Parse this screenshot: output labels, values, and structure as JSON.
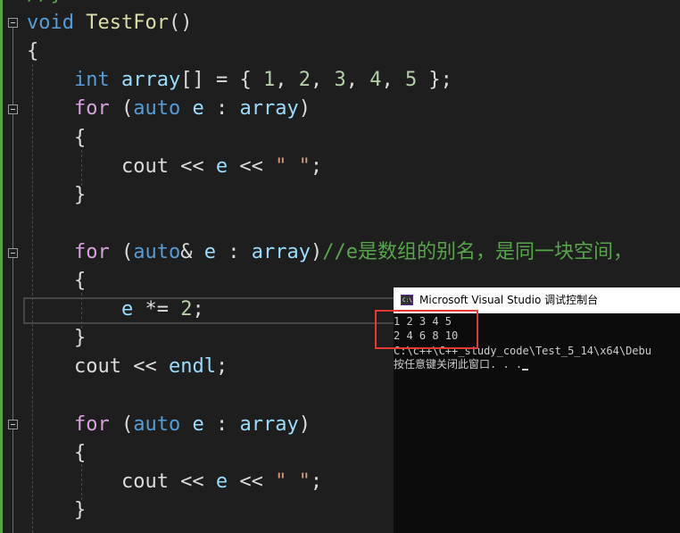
{
  "editor": {
    "lines": [
      {
        "tokens": [
          {
            "t": "//}",
            "c": "cmt"
          }
        ]
      },
      {
        "tokens": [
          {
            "t": "void",
            "c": "kw"
          },
          {
            "t": " ",
            "c": ""
          },
          {
            "t": "TestFor",
            "c": "fn"
          },
          {
            "t": "()",
            "c": ""
          }
        ]
      },
      {
        "tokens": [
          {
            "t": "{",
            "c": ""
          }
        ]
      },
      {
        "tokens": [
          {
            "t": "    ",
            "c": ""
          },
          {
            "t": "int",
            "c": "kw"
          },
          {
            "t": " ",
            "c": ""
          },
          {
            "t": "array",
            "c": "var"
          },
          {
            "t": "[] = { ",
            "c": ""
          },
          {
            "t": "1",
            "c": "num"
          },
          {
            "t": ", ",
            "c": ""
          },
          {
            "t": "2",
            "c": "num"
          },
          {
            "t": ", ",
            "c": ""
          },
          {
            "t": "3",
            "c": "num"
          },
          {
            "t": ", ",
            "c": ""
          },
          {
            "t": "4",
            "c": "num"
          },
          {
            "t": ", ",
            "c": ""
          },
          {
            "t": "5",
            "c": "num"
          },
          {
            "t": " };",
            "c": ""
          }
        ]
      },
      {
        "tokens": [
          {
            "t": "    ",
            "c": ""
          },
          {
            "t": "for",
            "c": "ctl"
          },
          {
            "t": " (",
            "c": ""
          },
          {
            "t": "auto",
            "c": "kw"
          },
          {
            "t": " ",
            "c": ""
          },
          {
            "t": "e",
            "c": "var"
          },
          {
            "t": " : ",
            "c": ""
          },
          {
            "t": "array",
            "c": "var"
          },
          {
            "t": ")",
            "c": ""
          }
        ]
      },
      {
        "tokens": [
          {
            "t": "    {",
            "c": ""
          }
        ]
      },
      {
        "tokens": [
          {
            "t": "        cout << ",
            "c": ""
          },
          {
            "t": "e",
            "c": "var"
          },
          {
            "t": " << ",
            "c": ""
          },
          {
            "t": "\" \"",
            "c": "str"
          },
          {
            "t": ";",
            "c": ""
          }
        ]
      },
      {
        "tokens": [
          {
            "t": "    }",
            "c": ""
          }
        ]
      },
      {
        "tokens": []
      },
      {
        "tokens": [
          {
            "t": "    ",
            "c": ""
          },
          {
            "t": "for",
            "c": "ctl"
          },
          {
            "t": " (",
            "c": ""
          },
          {
            "t": "auto",
            "c": "kw"
          },
          {
            "t": "& ",
            "c": ""
          },
          {
            "t": "e",
            "c": "var"
          },
          {
            "t": " : ",
            "c": ""
          },
          {
            "t": "array",
            "c": "var"
          },
          {
            "t": ")",
            "c": ""
          },
          {
            "t": "//e是数组的别名，是同一块空间，",
            "c": "cmt"
          }
        ]
      },
      {
        "tokens": [
          {
            "t": "    {",
            "c": ""
          }
        ]
      },
      {
        "tokens": [
          {
            "t": "        ",
            "c": ""
          },
          {
            "t": "e",
            "c": "var"
          },
          {
            "t": " *= ",
            "c": ""
          },
          {
            "t": "2",
            "c": "num"
          },
          {
            "t": ";",
            "c": ""
          }
        ]
      },
      {
        "tokens": [
          {
            "t": "    }",
            "c": ""
          }
        ]
      },
      {
        "tokens": [
          {
            "t": "    cout << ",
            "c": ""
          },
          {
            "t": "endl",
            "c": "var"
          },
          {
            "t": ";",
            "c": ""
          }
        ]
      },
      {
        "tokens": []
      },
      {
        "tokens": [
          {
            "t": "    ",
            "c": ""
          },
          {
            "t": "for",
            "c": "ctl"
          },
          {
            "t": " (",
            "c": ""
          },
          {
            "t": "auto",
            "c": "kw"
          },
          {
            "t": " ",
            "c": ""
          },
          {
            "t": "e",
            "c": "var"
          },
          {
            "t": " : ",
            "c": ""
          },
          {
            "t": "array",
            "c": "var"
          },
          {
            "t": ")",
            "c": ""
          }
        ]
      },
      {
        "tokens": [
          {
            "t": "    {",
            "c": ""
          }
        ]
      },
      {
        "tokens": [
          {
            "t": "        cout << ",
            "c": ""
          },
          {
            "t": "e",
            "c": "var"
          },
          {
            "t": " << ",
            "c": ""
          },
          {
            "t": "\" \"",
            "c": "str"
          },
          {
            "t": ";",
            "c": ""
          }
        ]
      },
      {
        "tokens": [
          {
            "t": "    }",
            "c": ""
          }
        ]
      }
    ],
    "colors": {
      "background": "#1e1e1e",
      "keyword": "#569cd6",
      "control": "#d8a0df",
      "function": "#dcdcaa",
      "variable": "#9cdcfe",
      "number": "#b5cea8",
      "string": "#d69d85",
      "comment": "#57a64a"
    }
  },
  "console": {
    "title": "Microsoft Visual Studio 调试控制台",
    "output": [
      "1 2 3 4 5",
      "2 4 6 8 10",
      "C:\\c++\\C++_study_code\\Test_5_14\\x64\\Debu",
      "按任意键关闭此窗口. . ."
    ],
    "colors": {
      "background": "#0c0c0c",
      "text": "#cccccc",
      "highlight_box": "#e53935"
    }
  }
}
